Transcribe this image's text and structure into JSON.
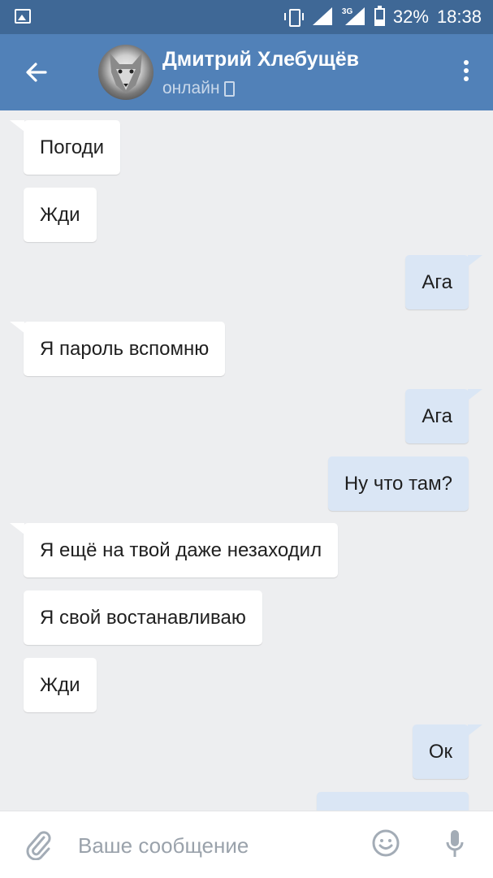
{
  "status_bar": {
    "battery": "32%",
    "time": "18:38",
    "network": "3G",
    "battery_level": 0.32
  },
  "header": {
    "back_icon": "arrow-left-icon",
    "contact_name": "Дмитрий Хлебущёв",
    "contact_status": "онлайн",
    "status_icon": "mobile-icon",
    "menu_icon": "more-vertical-icon"
  },
  "messages": [
    {
      "direction": "in",
      "text": "Погоди"
    },
    {
      "direction": "in",
      "text": "Жди"
    },
    {
      "direction": "out",
      "text": "Ага"
    },
    {
      "direction": "in",
      "text": "Я пароль вспомню"
    },
    {
      "direction": "out",
      "text": "Ага"
    },
    {
      "direction": "out",
      "text": "Ну что там?"
    },
    {
      "direction": "in",
      "text": "Я ещё на твой даже незаходил"
    },
    {
      "direction": "in",
      "text": "Я свой востанавливаю"
    },
    {
      "direction": "in",
      "text": "Жди"
    },
    {
      "direction": "out",
      "text": "Ок"
    }
  ],
  "composer": {
    "placeholder": "Ваше сообщение",
    "attach_icon": "paperclip-icon",
    "emoji_icon": "smile-icon",
    "mic_icon": "microphone-icon"
  },
  "colors": {
    "header": "#5181b8",
    "status_bar": "#3f6896",
    "outgoing_bubble": "#dae6f5",
    "incoming_bubble": "#ffffff"
  }
}
